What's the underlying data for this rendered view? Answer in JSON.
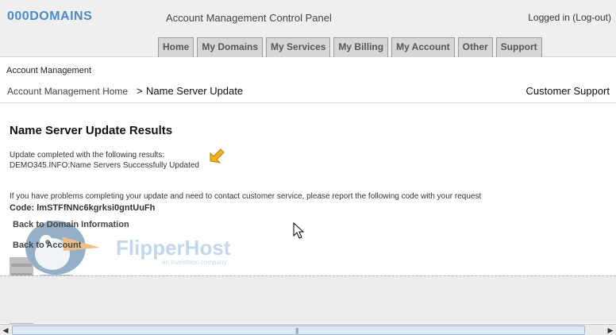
{
  "header": {
    "logo": "000DOMAINS",
    "panel_title": "Account Management Control Panel",
    "logged_in_text": "Logged in",
    "logout_label": "(Log-out)"
  },
  "nav": {
    "tabs": [
      {
        "label": "Home"
      },
      {
        "label": "My Domains"
      },
      {
        "label": "My Services"
      },
      {
        "label": "My Billing"
      },
      {
        "label": "My Account"
      },
      {
        "label": "Other"
      },
      {
        "label": "Support"
      }
    ]
  },
  "breadcrumb": {
    "section": "Account Management",
    "home_label": "Account Management Home",
    "separator": ">",
    "current": "Name Server Update",
    "support_label": "Customer Support"
  },
  "results": {
    "title": "Name Server Update Results",
    "intro": "Update completed with the following results:",
    "result_line": "DEMO345.INFO:Name Servers Successfully Updated",
    "problem_note": "If you have problems completing your update and need to contact customer service, please report the following code with your request",
    "code_label": "Code:",
    "code_value": "lmSTFfNNc6kgrksi0gntUuFh"
  },
  "links": {
    "back_domain": "Back to Domain Information",
    "back_account": "Back to Account"
  },
  "watermark": {
    "brand": "FlipperHost",
    "tagline": "an investition company"
  },
  "colors": {
    "logo_blue": "#4a8bc9",
    "header_bg": "#efefef",
    "tab_bg": "#d6d6d6",
    "pointer_yellow": "#f2b21b"
  },
  "icons": {
    "pointer": "yellow-arrow-pointer-icon",
    "cursor": "mouse-cursor-icon"
  }
}
